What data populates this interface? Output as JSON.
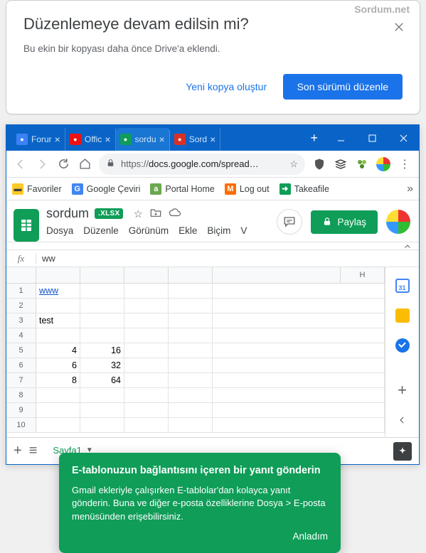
{
  "dialog": {
    "watermark": "Sordum.net",
    "title": "Düzenlemeye devam edilsin mi?",
    "body": "Bu ekin bir kopyası daha önce Drive'a eklendi.",
    "btn_new_copy": "Yeni kopya oluştur",
    "btn_edit_latest": "Son sürümü düzenle"
  },
  "browser": {
    "tabs": [
      {
        "label": "Forur",
        "icon_color": "#3b82f6"
      },
      {
        "label": "Offic",
        "icon_color": "#e11"
      },
      {
        "label": "sordu",
        "icon_color": "#0f9d58",
        "active": true
      },
      {
        "label": "Sord",
        "icon_color": "#d93025"
      }
    ],
    "url_scheme": "https://",
    "url_rest": "docs.google.com/spread…",
    "bookmarks": [
      {
        "label": "Favoriler",
        "icon": "folder"
      },
      {
        "label": "Google Çeviri",
        "icon": "gt"
      },
      {
        "label": "Portal Home",
        "icon": "a2"
      },
      {
        "label": "Log out",
        "icon": "m"
      },
      {
        "label": "Takeafile",
        "icon": "ta"
      }
    ]
  },
  "sheets": {
    "title": "sordum",
    "badge": ".XLSX",
    "share": "Paylaş",
    "menus": [
      "Dosya",
      "Düzenle",
      "Görünüm",
      "Ekle",
      "Biçim",
      "V"
    ],
    "fx_value": "ww",
    "cols": [
      "",
      "",
      "",
      "",
      "",
      "H"
    ],
    "rows": [
      [
        "www",
        "",
        "",
        "",
        "",
        ""
      ],
      [
        "",
        "",
        "",
        "",
        "",
        ""
      ],
      [
        "test",
        "",
        "",
        "",
        "",
        ""
      ],
      [
        "",
        "",
        "",
        "",
        "",
        ""
      ],
      [
        "4",
        "16",
        "",
        "",
        "",
        ""
      ],
      [
        "6",
        "32",
        "",
        "",
        "",
        ""
      ],
      [
        "8",
        "64",
        "",
        "",
        "",
        ""
      ],
      [
        "",
        "",
        "",
        "",
        "",
        ""
      ],
      [
        "",
        "",
        "",
        "",
        "",
        ""
      ],
      [
        "",
        "",
        "",
        "",
        "",
        ""
      ]
    ],
    "sheet_tab": "Sayfa1",
    "tooltip": {
      "title": "E-tablonuzun bağlantısını içeren bir yanıt gönderin",
      "body": "Gmail ekleriyle çalışırken E-tablolar'dan kolayca yanıt gönderin. Buna ve diğer e-posta özelliklerine Dosya > E-posta menüsünden erişebilirsiniz.",
      "ok": "Anladım"
    },
    "calendar_day": "31"
  }
}
